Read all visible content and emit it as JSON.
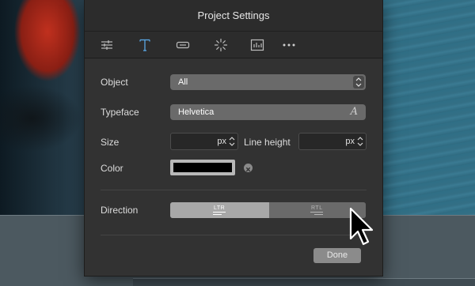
{
  "dialog": {
    "title": "Project Settings"
  },
  "toolbar": {
    "icons": [
      "sliders-icon",
      "text-icon",
      "button-icon",
      "spinner-icon",
      "chart-icon",
      "more-icon"
    ],
    "active": "text-icon"
  },
  "form": {
    "object_label": "Object",
    "object_value": "All",
    "typeface_label": "Typeface",
    "typeface_value": "Helvetica",
    "size_label": "Size",
    "size_unit": "px",
    "line_height_label": "Line height",
    "line_height_unit": "px",
    "color_label": "Color",
    "color_value": "#000000",
    "direction_label": "Direction",
    "direction_ltr": "LTR",
    "direction_rtl": "RTL",
    "direction_selected": "LTR"
  },
  "footer": {
    "done_label": "Done"
  },
  "colors": {
    "panel_bg": "#323232",
    "accent_active_icon": "#5aa9e6"
  }
}
